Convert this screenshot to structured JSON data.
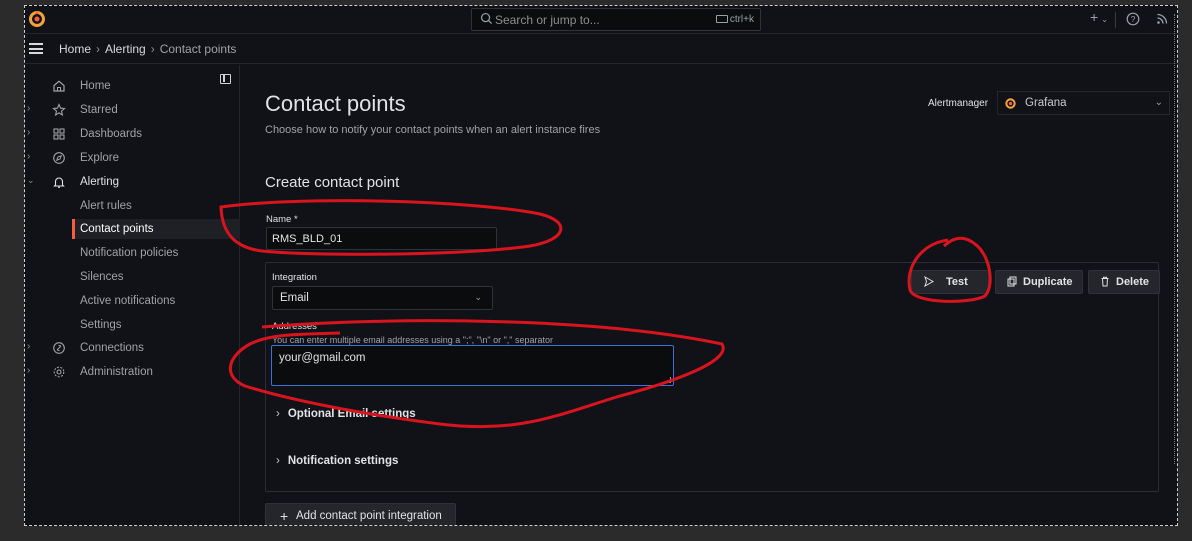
{
  "colors": {
    "brand": "#f55f3e",
    "annotation": "#d9141e",
    "focus": "#3d71d9",
    "background": "#111217"
  },
  "topbar": {
    "search_placeholder": "Search or jump to...",
    "shortcut": "ctrl+k",
    "new_label": "+",
    "icons": [
      "grafana-logo-icon",
      "search-icon",
      "keyboard-icon",
      "plus-icon",
      "help-icon",
      "rss-icon"
    ]
  },
  "breadcrumb": [
    "Home",
    "Alerting",
    "Contact points"
  ],
  "sidebar": {
    "items": [
      {
        "label": "Home",
        "icon": "home-icon"
      },
      {
        "label": "Starred",
        "icon": "star-icon"
      },
      {
        "label": "Dashboards",
        "icon": "dashboards-icon"
      },
      {
        "label": "Explore",
        "icon": "compass-icon"
      },
      {
        "label": "Alerting",
        "icon": "bell-icon"
      },
      {
        "label": "Connections",
        "icon": "link-icon"
      },
      {
        "label": "Administration",
        "icon": "cog-icon"
      }
    ],
    "alerting_children": [
      "Alert rules",
      "Contact points",
      "Notification policies",
      "Silences",
      "Active notifications",
      "Settings"
    ]
  },
  "page": {
    "title": "Contact points",
    "subtitle": "Choose how to notify your contact points when an alert instance fires",
    "alertmanager_label": "Alertmanager",
    "alertmanager_value": "Grafana"
  },
  "form": {
    "heading": "Create contact point",
    "name_label": "Name *",
    "name_value": "RMS_BLD_01",
    "integration_label": "Integration",
    "integration_value": "Email",
    "addresses_label": "Addresses",
    "addresses_desc": "You can enter multiple email addresses using a \";\", \"\\n\" or \",\" separator",
    "addresses_value": "your@gmail.com",
    "optional_settings": "Optional Email settings",
    "notification_settings": "Notification settings",
    "test_label": "Test",
    "duplicate_label": "Duplicate",
    "delete_label": "Delete",
    "add_integration_label": "Add contact point integration"
  }
}
